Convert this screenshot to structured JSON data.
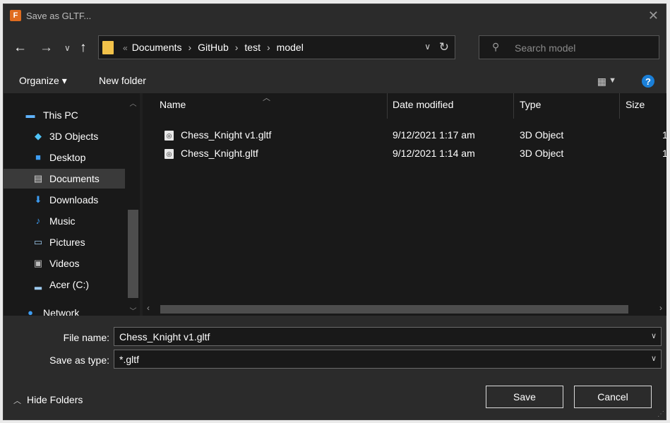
{
  "window": {
    "title": "Save as GLTF...",
    "app_icon_letter": "F"
  },
  "nav": {
    "back": "←",
    "forward": "→",
    "recent": "∨",
    "up": "↑",
    "breadcrumb": [
      "Documents",
      "GitHub",
      "test",
      "model"
    ],
    "refresh": "↻",
    "search_placeholder": "Search model"
  },
  "toolbar": {
    "organize": "Organize ▾",
    "new_folder": "New folder"
  },
  "sidebar": {
    "items": [
      {
        "label": "This PC",
        "icon": "computer-icon"
      },
      {
        "label": "3D Objects",
        "icon": "cube-icon"
      },
      {
        "label": "Desktop",
        "icon": "desktop-icon"
      },
      {
        "label": "Documents",
        "icon": "documents-icon",
        "selected": true
      },
      {
        "label": "Downloads",
        "icon": "download-icon"
      },
      {
        "label": "Music",
        "icon": "music-icon"
      },
      {
        "label": "Pictures",
        "icon": "pictures-icon"
      },
      {
        "label": "Videos",
        "icon": "videos-icon"
      },
      {
        "label": "Acer (C:)",
        "icon": "drive-icon"
      },
      {
        "label": "Network",
        "icon": "network-icon"
      }
    ]
  },
  "columns": {
    "name": "Name",
    "date": "Date modified",
    "type": "Type",
    "size": "Size"
  },
  "files": [
    {
      "name": "Chess_Knight v1.gltf",
      "date": "9/12/2021 1:17 am",
      "type": "3D Object",
      "size": "1"
    },
    {
      "name": "Chess_Knight.gltf",
      "date": "9/12/2021 1:14 am",
      "type": "3D Object",
      "size": "1"
    }
  ],
  "form": {
    "file_name_label": "File name:",
    "file_name_value": "Chess_Knight v1.gltf",
    "save_type_label": "Save as type:",
    "save_type_value": "*.gltf"
  },
  "footer": {
    "hide_folders": "Hide Folders",
    "save": "Save",
    "cancel": "Cancel"
  },
  "colors": {
    "accent": "#1a7fd8",
    "folder": "#f2c24a",
    "background": "#202020"
  }
}
